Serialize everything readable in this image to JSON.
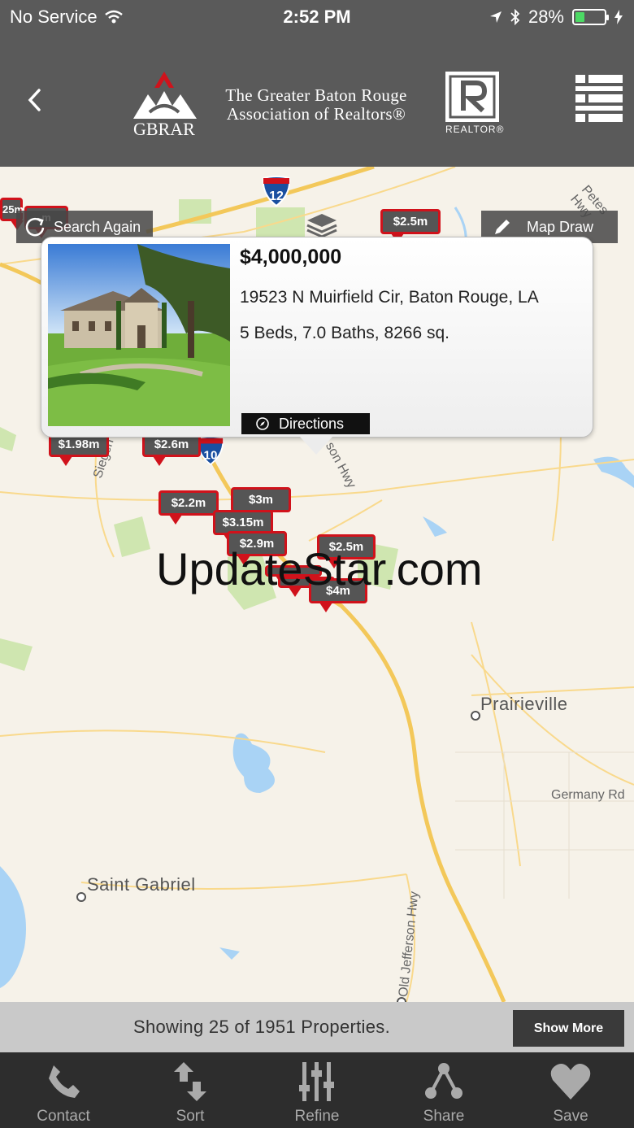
{
  "status_bar": {
    "carrier": "No Service",
    "time": "2:52 PM",
    "battery": "28%"
  },
  "header": {
    "logo_line1": "The Greater Baton Rouge",
    "logo_line2": "Association of Realtors®",
    "logo_abbrev": "GBRAR",
    "realtor_label": "REALTOR®"
  },
  "map": {
    "search_again_label": "Search Again",
    "map_draw_label": "Map Draw",
    "places": {
      "prairieville": "Prairieville",
      "saint_gabriel": "Saint Gabriel"
    },
    "roads": {
      "germany_rd": "Germany Rd",
      "siegen_ln": "Siegen Ln",
      "old_jefferson_hwy": "Old Jefferson Hwy",
      "jefferson_hwy": "son Hwy",
      "petes_hwy": "Petes Hwy"
    },
    "shields": {
      "i12": "12",
      "i10": "10"
    },
    "pins": [
      {
        "id": "pin-2-5m-top",
        "label": "$2.5m"
      },
      {
        "id": "pin-1-98m",
        "label": "$1.98m"
      },
      {
        "id": "pin-2-6m",
        "label": "$2.6m"
      },
      {
        "id": "pin-2-2m",
        "label": "$2.2m"
      },
      {
        "id": "pin-3m",
        "label": "$3m"
      },
      {
        "id": "pin-3-15m",
        "label": "$3.15m"
      },
      {
        "id": "pin-2-9m",
        "label": "$2.9m"
      },
      {
        "id": "pin-2-5m",
        "label": "$2.5m"
      },
      {
        "id": "pin-4m",
        "label": "$4m"
      },
      {
        "id": "pin-edge-1",
        "label": "25m"
      },
      {
        "id": "pin-edge-2",
        "label": "m"
      }
    ]
  },
  "popup": {
    "price": "$4,000,000",
    "address": "19523 N Muirfield Cir, Baton Rouge, LA",
    "details": "5 Beds, 7.0 Baths, 8266 sq.",
    "directions_label": "Directions"
  },
  "watermark": "UpdateStar.com",
  "footer": {
    "count_text": "Showing 25 of 1951 Properties.",
    "show_more_label": "Show More"
  },
  "tabs": [
    {
      "label": "Contact",
      "icon": "phone-icon"
    },
    {
      "label": "Sort",
      "icon": "sort-icon"
    },
    {
      "label": "Refine",
      "icon": "sliders-icon"
    },
    {
      "label": "Share",
      "icon": "share-icon"
    },
    {
      "label": "Save",
      "icon": "heart-icon"
    }
  ],
  "colors": {
    "header_bg": "#5a5a5a",
    "pin_border": "#d0121b",
    "pin_bg": "#555555",
    "tabbar_bg": "#2d2d2d",
    "map_bg": "#f6f2e9",
    "water": "#a9d3f5",
    "highway": "#f3c85a"
  }
}
